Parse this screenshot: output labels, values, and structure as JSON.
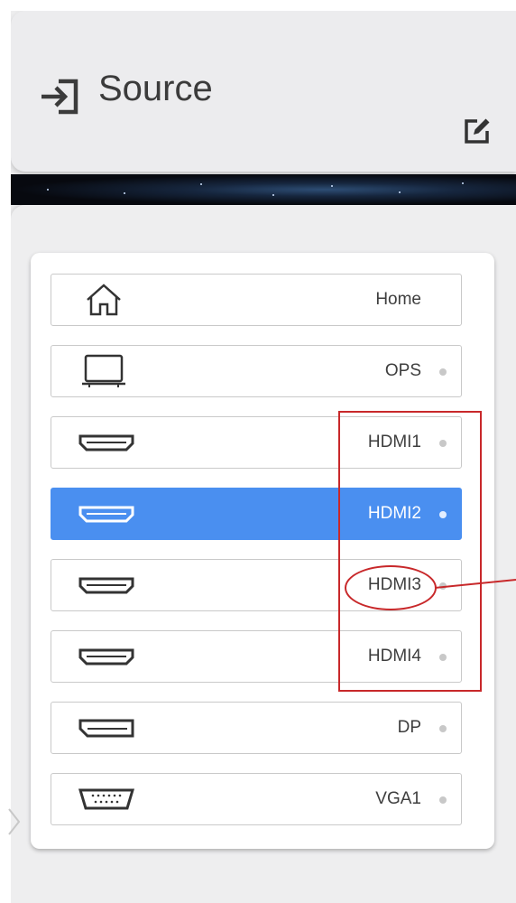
{
  "header": {
    "title": "Source",
    "title_icon": "source-input-icon",
    "edit_icon": "edit-icon"
  },
  "sources": [
    {
      "label": "Home",
      "icon": "home-icon",
      "active": false,
      "has_dot": false
    },
    {
      "label": "OPS",
      "icon": "monitor-icon",
      "active": false,
      "has_dot": true
    },
    {
      "label": "HDMI1",
      "icon": "hdmi-port-icon",
      "active": false,
      "has_dot": true
    },
    {
      "label": "HDMI2",
      "icon": "hdmi-port-icon",
      "active": true,
      "has_dot": true
    },
    {
      "label": "HDMI3",
      "icon": "hdmi-port-icon",
      "active": false,
      "has_dot": true
    },
    {
      "label": "HDMI4",
      "icon": "hdmi-port-icon",
      "active": false,
      "has_dot": true
    },
    {
      "label": "DP",
      "icon": "displayport-icon",
      "active": false,
      "has_dot": true
    },
    {
      "label": "VGA1",
      "icon": "vga-port-icon",
      "active": false,
      "has_dot": true
    }
  ],
  "colors": {
    "active_background": "#4a8ff0",
    "annotation": "#c8282a"
  }
}
